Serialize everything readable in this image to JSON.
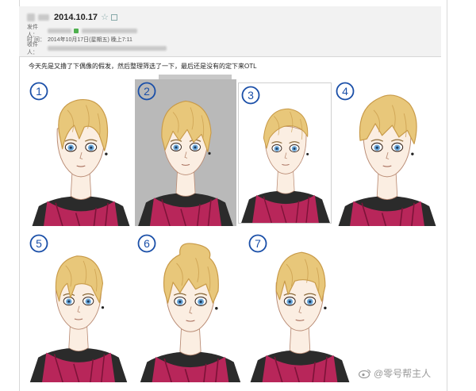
{
  "mail": {
    "subject_date": "2014.10.17",
    "sender_label": "发件人：",
    "time_label": "时 间：",
    "time_value": "2014年10月17日(星期五) 晚上7:11",
    "recipient_label": "收件人："
  },
  "body_text": "今天先是又撸了下偶像的假发，然后整理筛选了一下，最后还是没有的定下来OTL",
  "panels": [
    {
      "number": "1"
    },
    {
      "number": "2"
    },
    {
      "number": "3"
    },
    {
      "number": "4"
    },
    {
      "number": "5"
    },
    {
      "number": "6"
    },
    {
      "number": "7"
    }
  ],
  "watermark": "@零号帮主人",
  "colors": {
    "number_blue": "#1a4fa8",
    "hair_blonde": "#e8c77a",
    "hair_shadow": "#c89a48",
    "skin": "#fbeee2",
    "eye_blue": "#6aa6d8",
    "scarf_magenta": "#b8265a",
    "coat_dark": "#2b2b2b"
  }
}
